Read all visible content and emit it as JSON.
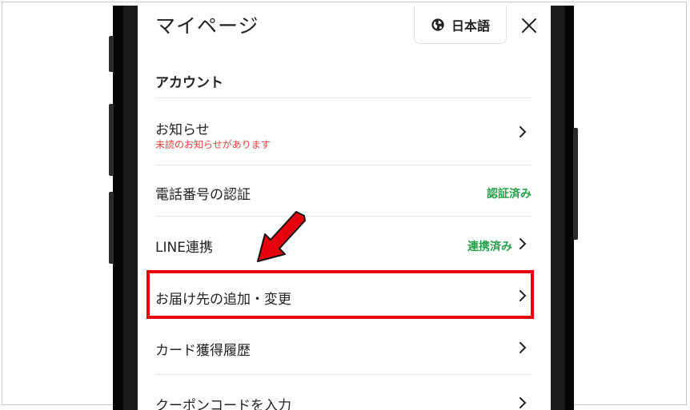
{
  "header": {
    "title": "マイページ",
    "language_label": "日本語"
  },
  "section_title": "アカウント",
  "rows": [
    {
      "label": "お知らせ",
      "sublabel": "未読のお知らせがあります"
    },
    {
      "label": "電話番号の認証",
      "status": "認証済み"
    },
    {
      "label": "LINE連携",
      "status": "連携済み"
    },
    {
      "label": "お届け先の追加・変更"
    },
    {
      "label": "カード獲得履歴"
    },
    {
      "label": "クーポンコードを入力"
    }
  ],
  "colors": {
    "status_green": "#24a148",
    "notice_red": "#e0423b",
    "highlight_red": "#e5000c"
  },
  "icons": {
    "language": "globe-icon",
    "close": "close-icon",
    "row_chevron": "chevron-right-icon",
    "annotation": "red-arrow-icon"
  }
}
